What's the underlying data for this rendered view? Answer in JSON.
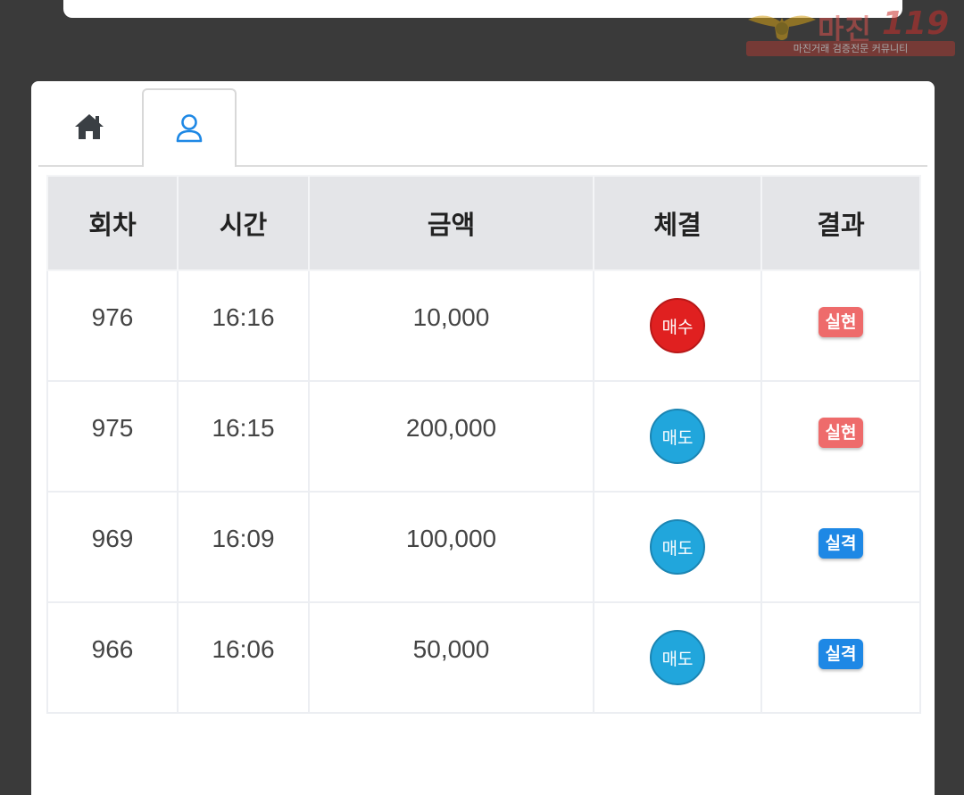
{
  "watermark": {
    "brand": "마진",
    "number": "119",
    "subtitle": "마진거래 검증전문 커뮤니티"
  },
  "tabs": [
    {
      "icon": "home-icon",
      "active": false
    },
    {
      "icon": "user-icon",
      "active": true
    }
  ],
  "colors": {
    "accent": "#1e88e5",
    "buy": "#e02020",
    "sell": "#21a6dc",
    "hit": "#ee6b6b",
    "miss": "#1e88e5"
  },
  "table": {
    "headers": [
      "회차",
      "시간",
      "금액",
      "체결",
      "결과"
    ],
    "rows": [
      {
        "round": "976",
        "time": "16:16",
        "amount": "10,000",
        "exec": "매수",
        "exec_type": "buy",
        "result": "실현",
        "result_type": "hit"
      },
      {
        "round": "975",
        "time": "16:15",
        "amount": "200,000",
        "exec": "매도",
        "exec_type": "sell",
        "result": "실현",
        "result_type": "hit"
      },
      {
        "round": "969",
        "time": "16:09",
        "amount": "100,000",
        "exec": "매도",
        "exec_type": "sell",
        "result": "실격",
        "result_type": "miss"
      },
      {
        "round": "966",
        "time": "16:06",
        "amount": "50,000",
        "exec": "매도",
        "exec_type": "sell",
        "result": "실격",
        "result_type": "miss"
      }
    ]
  }
}
